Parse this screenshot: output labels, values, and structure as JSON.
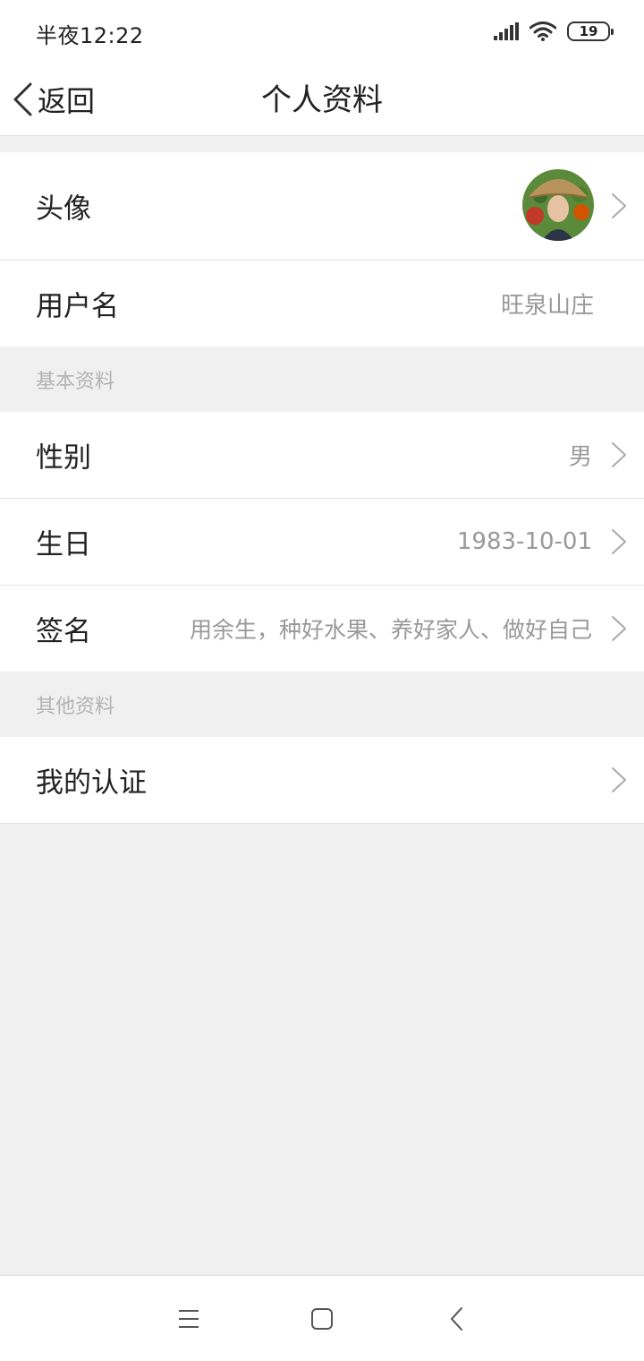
{
  "status_bar": {
    "time": "半夜12:22",
    "battery_level": "19",
    "icons": [
      "signal-icon",
      "wifi-icon",
      "battery-icon"
    ]
  },
  "nav": {
    "back_label": "返回",
    "title": "个人资料"
  },
  "profile": {
    "avatar_label": "头像",
    "username_label": "用户名",
    "username_value": "旺泉山庄"
  },
  "basic_section": {
    "title": "基本资料",
    "gender_label": "性别",
    "gender_value": "男",
    "birthday_label": "生日",
    "birthday_value": "1983-10-01",
    "signature_label": "签名",
    "signature_value": "用余生，种好水果、养好家人、做好自己"
  },
  "other_section": {
    "title": "其他资料",
    "certification_label": "我的认证"
  },
  "system_nav": {
    "icons": [
      "menu-icon",
      "home-icon",
      "back-icon"
    ]
  },
  "colors": {
    "background": "#f0f0f0",
    "row_background": "#ffffff",
    "primary_text": "#222222",
    "secondary_text": "#999999",
    "section_text": "#b3b3b3"
  }
}
